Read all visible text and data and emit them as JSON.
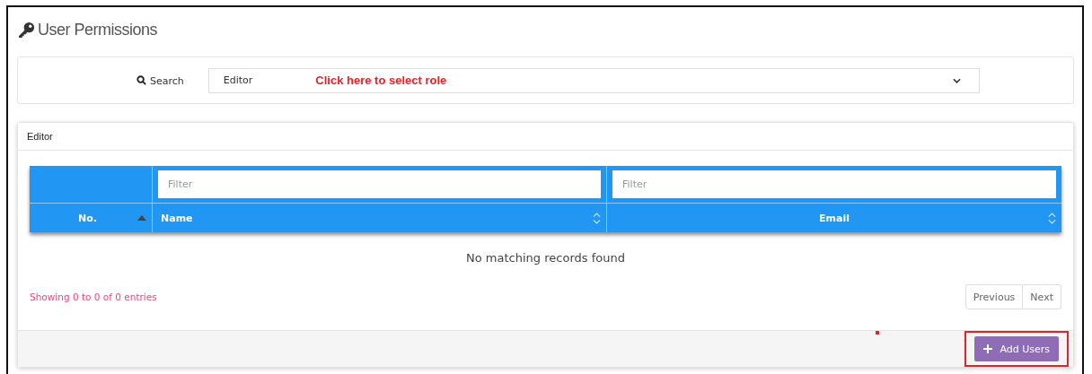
{
  "page": {
    "title": "User Permissions"
  },
  "search": {
    "label": "Search",
    "value": "Editor",
    "hint": "Click here to select role"
  },
  "panel": {
    "title": "Editor"
  },
  "table": {
    "columns": [
      {
        "label": "No.",
        "sorted": true
      },
      {
        "label": "Name",
        "sorted": false,
        "filter_placeholder": "Filter"
      },
      {
        "label": "Email",
        "sorted": false,
        "filter_placeholder": "Filter"
      }
    ],
    "empty_message": "No matching records found"
  },
  "info": "Showing 0 to 0 of 0 entries",
  "pagination": [
    {
      "label": "Previous"
    },
    {
      "label": "Next"
    }
  ],
  "add_button": {
    "label": "Add Users",
    "highlighted": true
  }
}
